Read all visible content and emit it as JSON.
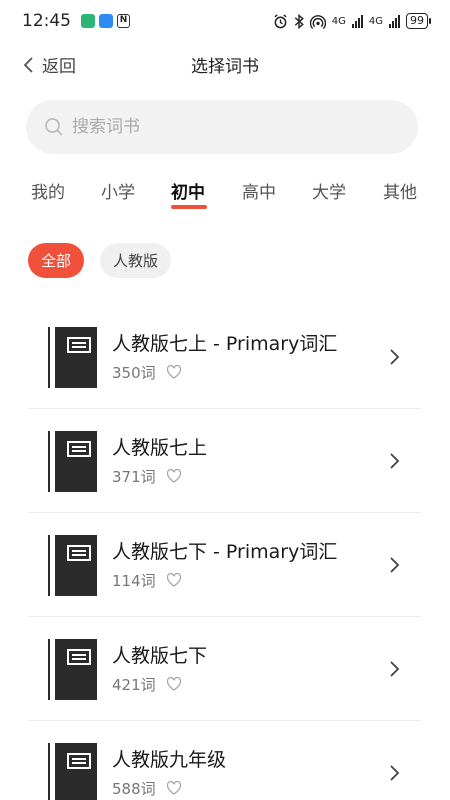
{
  "status": {
    "time": "12:45",
    "net1": "4G",
    "net2": "4G",
    "battery": "99"
  },
  "header": {
    "back_label": "返回",
    "title": "选择词书"
  },
  "search": {
    "placeholder": "搜索词书"
  },
  "tabs": [
    {
      "label": "我的"
    },
    {
      "label": "小学"
    },
    {
      "label": "初中"
    },
    {
      "label": "高中"
    },
    {
      "label": "大学"
    },
    {
      "label": "其他"
    }
  ],
  "active_tab": "初中",
  "chips": [
    {
      "label": "全部"
    },
    {
      "label": "人教版"
    }
  ],
  "books": [
    {
      "title": "人教版七上 - Primary词汇",
      "count": "350词"
    },
    {
      "title": "人教版七上",
      "count": "371词"
    },
    {
      "title": "人教版七下 - Primary词汇",
      "count": "114词"
    },
    {
      "title": "人教版七下",
      "count": "421词"
    },
    {
      "title": "人教版九年级",
      "count": "588词"
    }
  ],
  "colors": {
    "accent": "#f1503b"
  }
}
